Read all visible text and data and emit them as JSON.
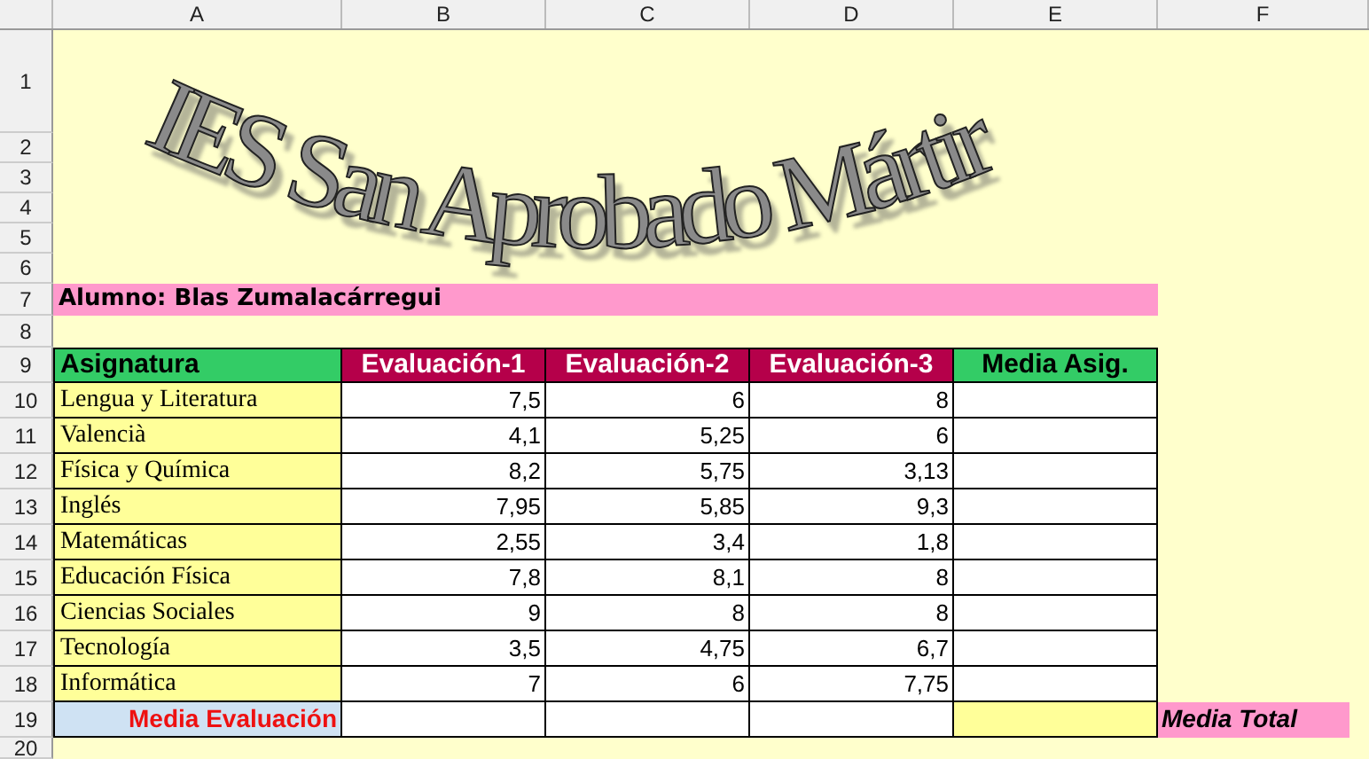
{
  "columns": [
    "A",
    "B",
    "C",
    "D",
    "E",
    "F"
  ],
  "row_numbers": [
    "1",
    "2",
    "3",
    "4",
    "5",
    "6",
    "7",
    "8",
    "9",
    "10",
    "11",
    "12",
    "13",
    "14",
    "15",
    "16",
    "17",
    "18",
    "19",
    "20"
  ],
  "title": "IES San Aprobado Mártir",
  "student": "Alumno: Blas Zumalacárregui",
  "headers": [
    {
      "label": "Asignatura",
      "kind": "subject"
    },
    {
      "label": "Evaluación-1",
      "kind": "evaluation"
    },
    {
      "label": "Evaluación-2",
      "kind": "evaluation"
    },
    {
      "label": "Evaluación-3",
      "kind": "evaluation"
    },
    {
      "label": "Media Asig.",
      "kind": "average"
    }
  ],
  "rows": [
    {
      "subject": "Lengua y Literatura",
      "grades": [
        "7,5",
        "6",
        "8"
      ]
    },
    {
      "subject": "Valencià",
      "grades": [
        "4,1",
        "5,25",
        "6"
      ]
    },
    {
      "subject": "Física y Química",
      "grades": [
        "8,2",
        "5,75",
        "3,13"
      ]
    },
    {
      "subject": "Inglés",
      "grades": [
        "7,95",
        "5,85",
        "9,3"
      ]
    },
    {
      "subject": "Matemáticas",
      "grades": [
        "2,55",
        "3,4",
        "1,8"
      ]
    },
    {
      "subject": "Educación Física",
      "grades": [
        "7,8",
        "8,1",
        "8"
      ]
    },
    {
      "subject": "Ciencias Sociales",
      "grades": [
        "9",
        "8",
        "8"
      ]
    },
    {
      "subject": "Tecnología",
      "grades": [
        "3,5",
        "4,75",
        "6,7"
      ]
    },
    {
      "subject": "Informática",
      "grades": [
        "7",
        "6",
        "7,75"
      ]
    }
  ],
  "footer": {
    "label": "Media Evaluación",
    "total_label": "Media Total"
  }
}
